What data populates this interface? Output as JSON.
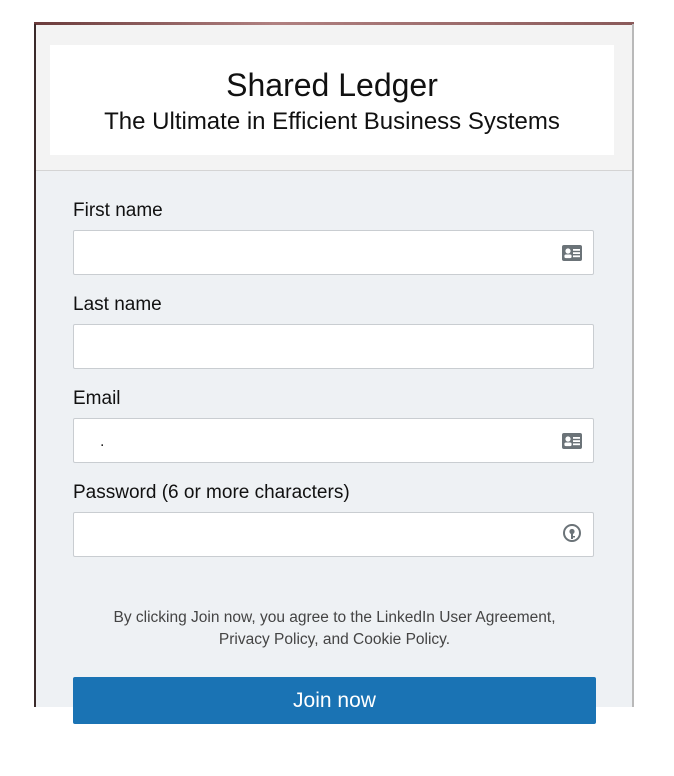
{
  "header": {
    "title": "Shared Ledger",
    "subtitle": "The Ultimate in Efficient Business Systems"
  },
  "form": {
    "first_name": {
      "label": "First name",
      "value": "",
      "icon": "contact-card-icon"
    },
    "last_name": {
      "label": "Last name",
      "value": ""
    },
    "email": {
      "label": "Email",
      "value": ".",
      "icon": "contact-card-icon"
    },
    "password": {
      "label": "Password (6 or more characters)",
      "value": "",
      "icon": "password-key-icon"
    }
  },
  "terms": {
    "line1": "By clicking Join now, you agree to the LinkedIn User Agreement,",
    "line2": "Privacy Policy, and Cookie Policy."
  },
  "join_button": {
    "label": "Join now"
  },
  "colors": {
    "button": "#1a73b4",
    "panel": "#eef1f4"
  }
}
